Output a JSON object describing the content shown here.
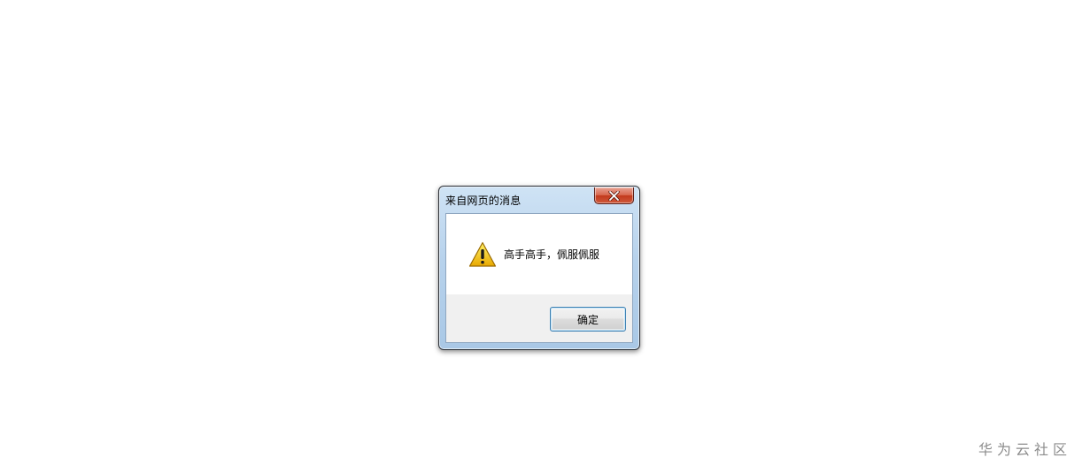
{
  "dialog": {
    "title": "来自网页的消息",
    "message": "高手高手，佩服佩服",
    "ok_label": "确定",
    "close_glyph": "close-icon",
    "icon": "warning-icon"
  },
  "watermark": {
    "text": "华为云社区"
  },
  "colors": {
    "frame_accent": "#b7d2ec",
    "close_button": "#c2391c",
    "button_border": "#3c7fb1",
    "warning_yellow": "#f5c400"
  }
}
